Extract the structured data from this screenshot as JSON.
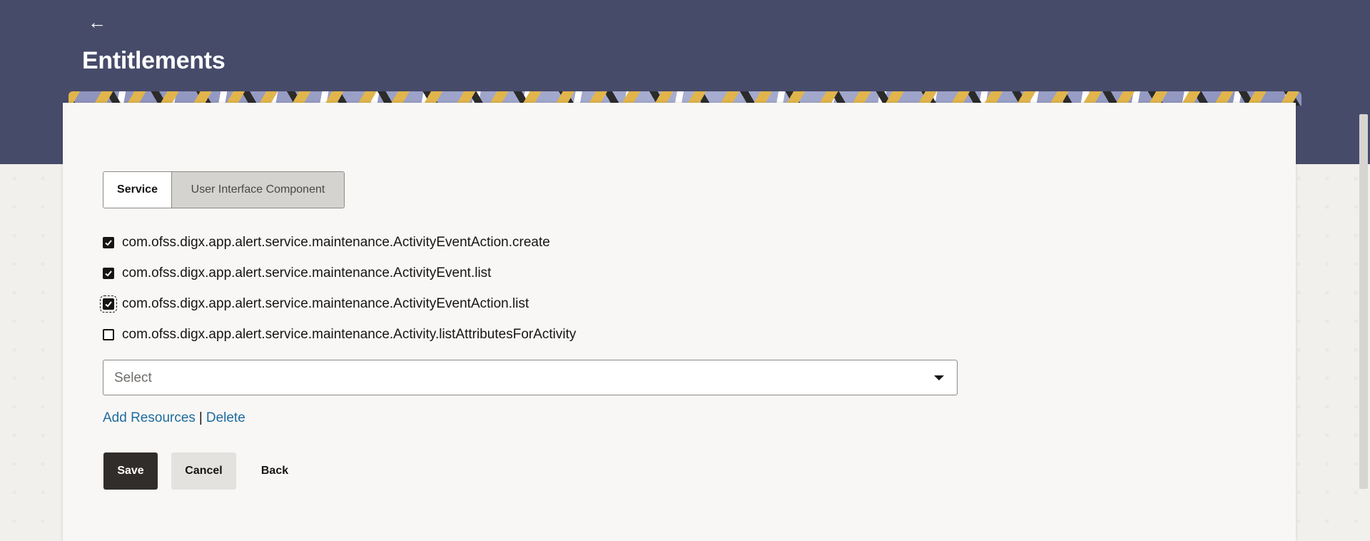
{
  "header": {
    "back_icon": "back-arrow-icon",
    "title": "Entitlements"
  },
  "tabs": [
    {
      "label": "Service",
      "selected": true
    },
    {
      "label": "User Interface Component",
      "selected": false
    }
  ],
  "services": [
    {
      "label": "com.ofss.digx.app.alert.service.maintenance.ActivityEventAction.create",
      "checked": true
    },
    {
      "label": "com.ofss.digx.app.alert.service.maintenance.ActivityEvent.list",
      "checked": true
    },
    {
      "label": "com.ofss.digx.app.alert.service.maintenance.ActivityEventAction.list",
      "checked": true
    },
    {
      "label": "com.ofss.digx.app.alert.service.maintenance.Activity.listAttributesForActivity",
      "checked": false
    }
  ],
  "select": {
    "placeholder": "Select",
    "icon": "chevron-down-icon"
  },
  "links": {
    "add_resources": "Add Resources",
    "separator": "|",
    "delete": "Delete"
  },
  "actions": {
    "save": "Save",
    "cancel": "Cancel",
    "back": "Back"
  },
  "colors": {
    "header_bg": "#474b6a",
    "primary_button": "#312d2a",
    "link": "#1f6ba0"
  }
}
